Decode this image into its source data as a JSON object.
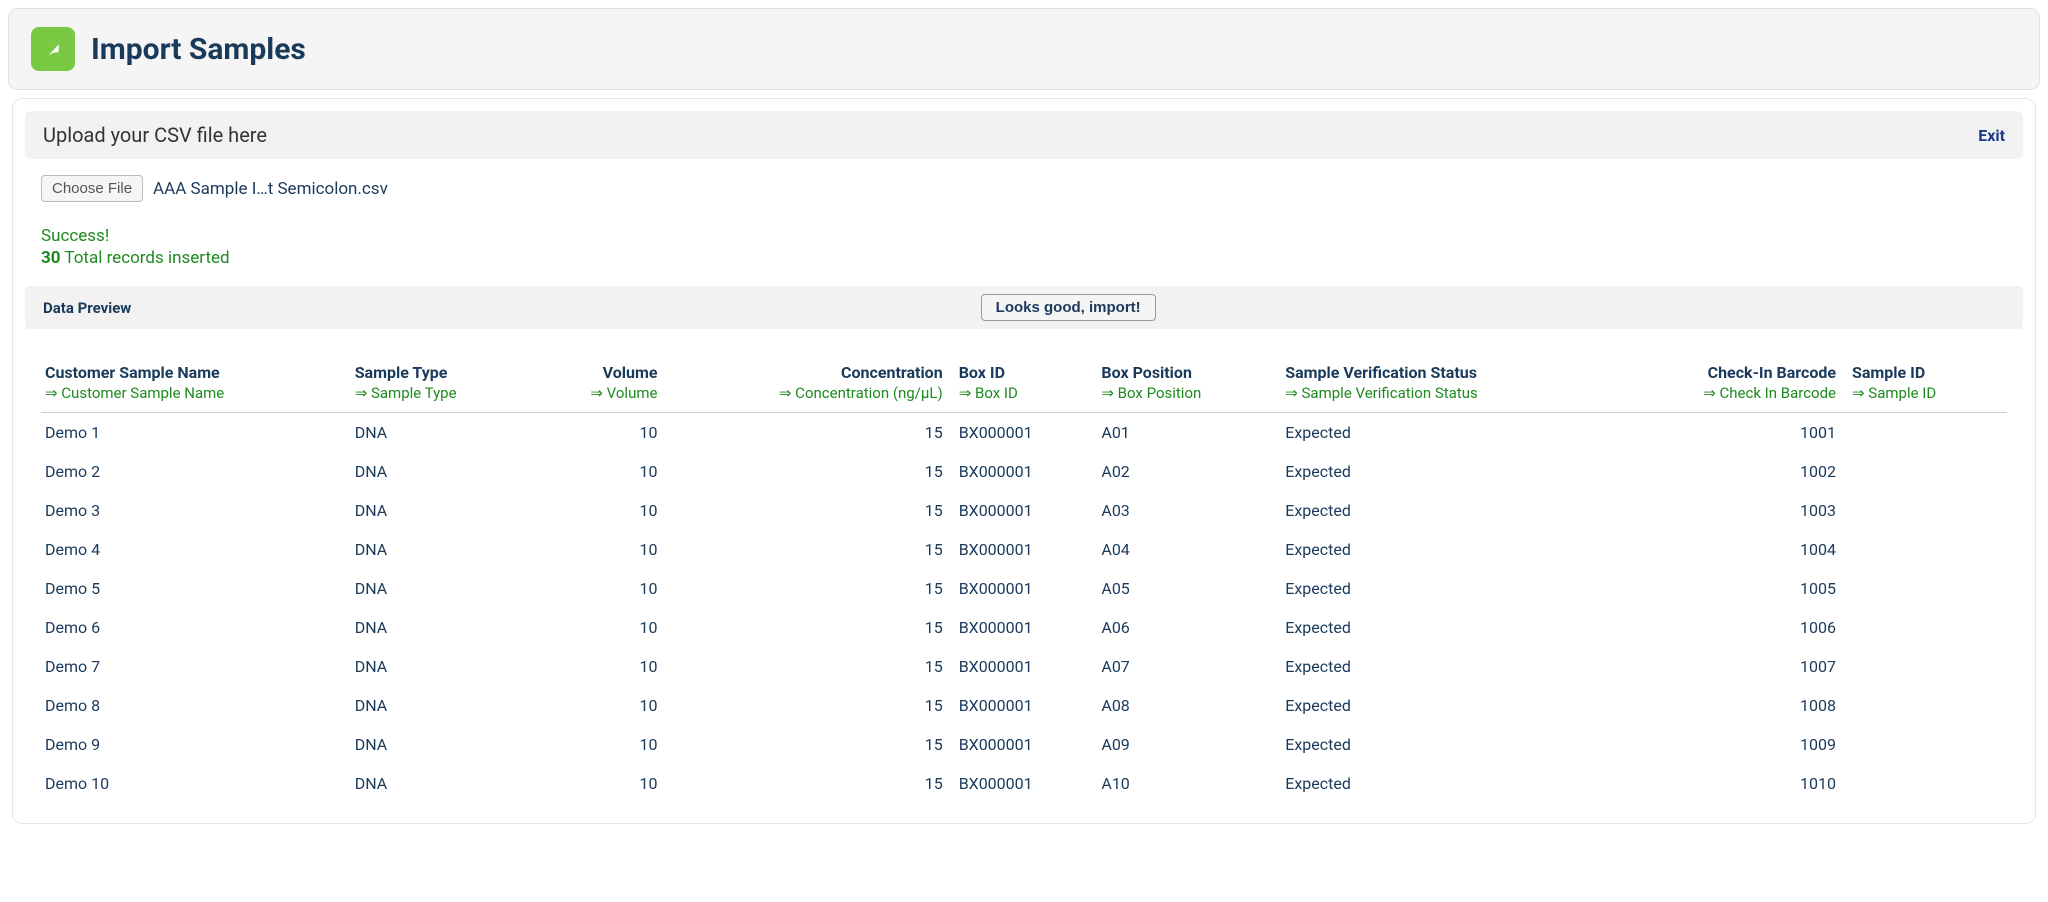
{
  "header": {
    "title": "Import Samples"
  },
  "upload": {
    "prompt": "Upload your CSV file here",
    "exit": "Exit",
    "choose_label": "Choose File",
    "filename": "AAA Sample I…t Semicolon.csv"
  },
  "status": {
    "success": "Success!",
    "count": "30",
    "records_text": " Total records inserted"
  },
  "preview": {
    "label": "Data Preview",
    "import_button": "Looks good, import!"
  },
  "arrow": "⇒ ",
  "columns": [
    {
      "label": "Customer Sample Name",
      "mapping": "Customer Sample Name",
      "key": "name",
      "align": "left"
    },
    {
      "label": "Sample Type",
      "mapping": "Sample Type",
      "key": "type",
      "align": "left"
    },
    {
      "label": "Volume",
      "mapping": "Volume",
      "key": "volume",
      "align": "right"
    },
    {
      "label": "Concentration",
      "mapping": "Concentration (ng/µL)",
      "key": "conc",
      "align": "right"
    },
    {
      "label": "Box ID",
      "mapping": "Box ID",
      "key": "boxid",
      "align": "left"
    },
    {
      "label": "Box Position",
      "mapping": "Box Position",
      "key": "boxpos",
      "align": "left"
    },
    {
      "label": "Sample Verification Status",
      "mapping": "Sample Verification Status",
      "key": "status",
      "align": "left"
    },
    {
      "label": "Check-In Barcode",
      "mapping": "Check In Barcode",
      "key": "barcode",
      "align": "right"
    },
    {
      "label": "Sample ID",
      "mapping": "Sample ID",
      "key": "sampleid",
      "align": "left"
    }
  ],
  "rows": [
    {
      "name": "Demo 1",
      "type": "DNA",
      "volume": "10",
      "conc": "15",
      "boxid": "BX000001",
      "boxpos": "A01",
      "status": "Expected",
      "barcode": "1001",
      "sampleid": ""
    },
    {
      "name": "Demo 2",
      "type": "DNA",
      "volume": "10",
      "conc": "15",
      "boxid": "BX000001",
      "boxpos": "A02",
      "status": "Expected",
      "barcode": "1002",
      "sampleid": ""
    },
    {
      "name": "Demo 3",
      "type": "DNA",
      "volume": "10",
      "conc": "15",
      "boxid": "BX000001",
      "boxpos": "A03",
      "status": "Expected",
      "barcode": "1003",
      "sampleid": ""
    },
    {
      "name": "Demo 4",
      "type": "DNA",
      "volume": "10",
      "conc": "15",
      "boxid": "BX000001",
      "boxpos": "A04",
      "status": "Expected",
      "barcode": "1004",
      "sampleid": ""
    },
    {
      "name": "Demo 5",
      "type": "DNA",
      "volume": "10",
      "conc": "15",
      "boxid": "BX000001",
      "boxpos": "A05",
      "status": "Expected",
      "barcode": "1005",
      "sampleid": ""
    },
    {
      "name": "Demo 6",
      "type": "DNA",
      "volume": "10",
      "conc": "15",
      "boxid": "BX000001",
      "boxpos": "A06",
      "status": "Expected",
      "barcode": "1006",
      "sampleid": ""
    },
    {
      "name": "Demo 7",
      "type": "DNA",
      "volume": "10",
      "conc": "15",
      "boxid": "BX000001",
      "boxpos": "A07",
      "status": "Expected",
      "barcode": "1007",
      "sampleid": ""
    },
    {
      "name": "Demo 8",
      "type": "DNA",
      "volume": "10",
      "conc": "15",
      "boxid": "BX000001",
      "boxpos": "A08",
      "status": "Expected",
      "barcode": "1008",
      "sampleid": ""
    },
    {
      "name": "Demo 9",
      "type": "DNA",
      "volume": "10",
      "conc": "15",
      "boxid": "BX000001",
      "boxpos": "A09",
      "status": "Expected",
      "barcode": "1009",
      "sampleid": ""
    },
    {
      "name": "Demo 10",
      "type": "DNA",
      "volume": "10",
      "conc": "15",
      "boxid": "BX000001",
      "boxpos": "A10",
      "status": "Expected",
      "barcode": "1010",
      "sampleid": ""
    }
  ]
}
